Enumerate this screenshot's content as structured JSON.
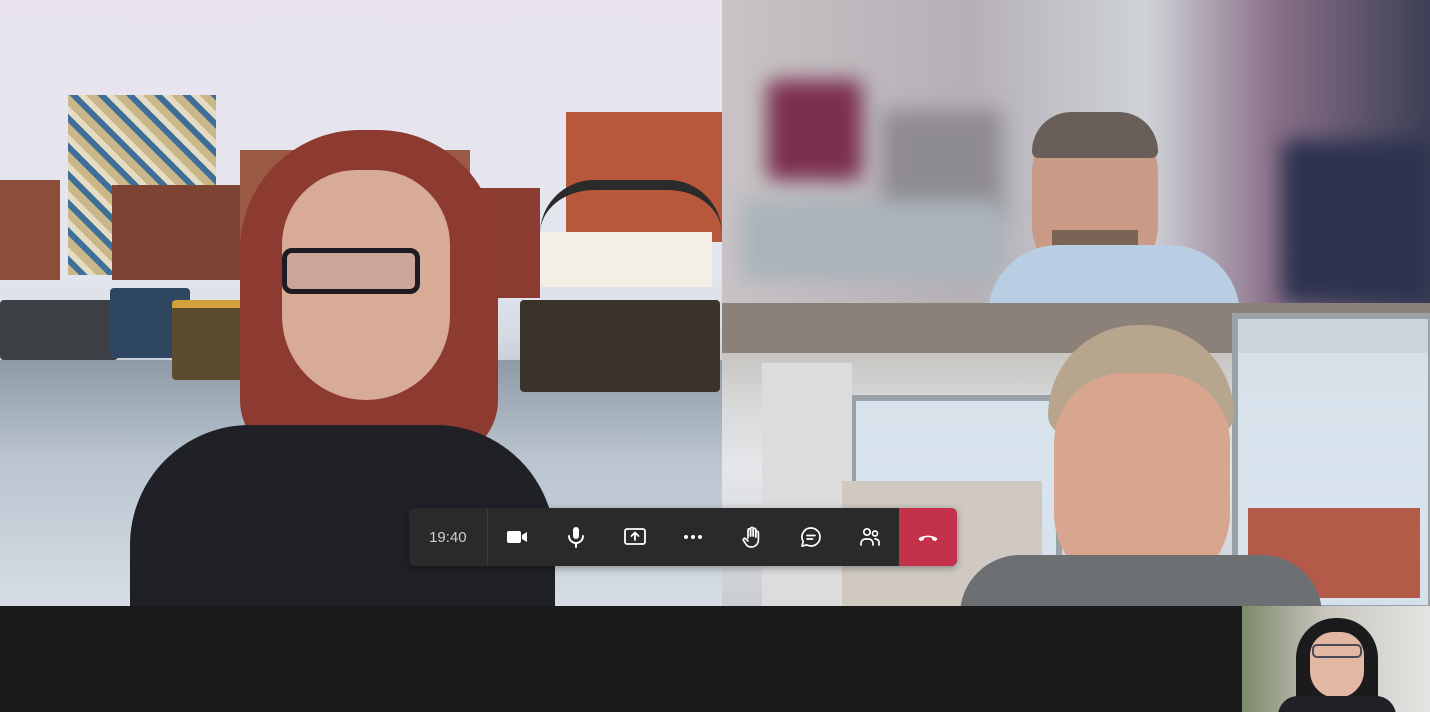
{
  "meeting": {
    "elapsed_time": "19:40"
  },
  "toolbar": {
    "buttons": [
      {
        "name": "camera-toggle",
        "icon": "video-camera-icon"
      },
      {
        "name": "mic-toggle",
        "icon": "microphone-icon"
      },
      {
        "name": "share-screen",
        "icon": "share-screen-icon"
      },
      {
        "name": "more-actions",
        "icon": "ellipsis-icon"
      },
      {
        "name": "raise-hand",
        "icon": "raise-hand-icon"
      },
      {
        "name": "chat",
        "icon": "chat-bubble-icon"
      },
      {
        "name": "participants",
        "icon": "people-icon"
      },
      {
        "name": "leave-call",
        "icon": "hang-up-icon"
      }
    ]
  },
  "colors": {
    "toolbar_bg": "#2a2a2a",
    "hangup": "#c4314b",
    "stage_bg": "#1b1b1b",
    "icon": "#ffffff"
  },
  "participants": [
    {
      "tile": "main",
      "background": "canal-virtual-background"
    },
    {
      "tile": "top-right",
      "background": "blurred"
    },
    {
      "tile": "bottom-right",
      "background": "office"
    },
    {
      "tile": "self-view",
      "background": "office"
    }
  ]
}
